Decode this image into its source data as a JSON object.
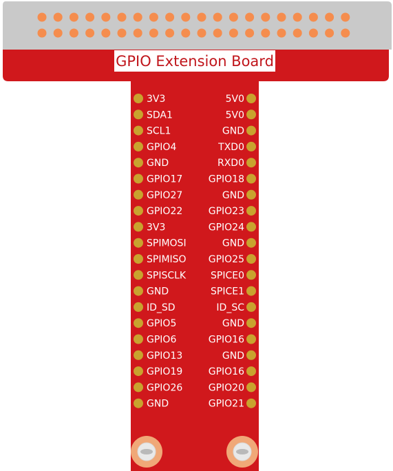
{
  "board": {
    "title": "GPIO Extension Board",
    "colors": {
      "pcb_red": "#d0181c",
      "connector_gray": "#c9c9c9",
      "header_pin": "#f58d4e",
      "pad_gold": "#c9a32e",
      "mount_ring": "#f0a878",
      "label_text": "#ffffff"
    },
    "left_pins": [
      "3V3",
      "SDA1",
      "SCL1",
      "GPIO4",
      "GND",
      "GPIO17",
      "GPIO27",
      "GPIO22",
      "3V3",
      "SPIMOSI",
      "SPIMISO",
      "SPISCLK",
      "GND",
      "ID_SD",
      "GPIO5",
      "GPIO6",
      "GPIO13",
      "GPIO19",
      "GPIO26",
      "GND"
    ],
    "right_pins": [
      "5V0",
      "5V0",
      "GND",
      "TXD0",
      "RXD0",
      "GPIO18",
      "GND",
      "GPIO23",
      "GPIO24",
      "GND",
      "GPIO25",
      "SPICE0",
      "SPICE1",
      "ID_SC",
      "GND",
      "GPIO16",
      "GND",
      "GPIO16",
      "GPIO20",
      "GPIO21"
    ]
  }
}
